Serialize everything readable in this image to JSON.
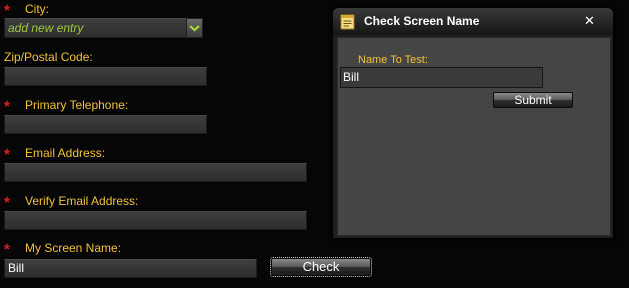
{
  "form": {
    "city": {
      "label": "City:",
      "value": "add new entry"
    },
    "zip": {
      "label": "Zip/Postal Code:",
      "value": ""
    },
    "phone": {
      "label": "Primary Telephone:",
      "value": ""
    },
    "email": {
      "label": "Email Address:",
      "value": ""
    },
    "verify_email": {
      "label": "Verify Email Address:",
      "value": ""
    },
    "screen_name": {
      "label": "My Screen Name:",
      "value": "Bill"
    },
    "required_marker": "*",
    "check_button": "Check"
  },
  "dialog": {
    "title": "Check Screen Name",
    "close_glyph": "✕",
    "name_label": "Name To Test:",
    "name_value": "Bill",
    "submit_button": "Submit"
  },
  "colors": {
    "background": "#060606",
    "label": "#f2c23a",
    "required": "#e02020",
    "combo_text": "#9ccc3c"
  },
  "icons": {
    "combo_arrow": "chevron-down-icon",
    "dialog_icon": "notepad-icon"
  }
}
